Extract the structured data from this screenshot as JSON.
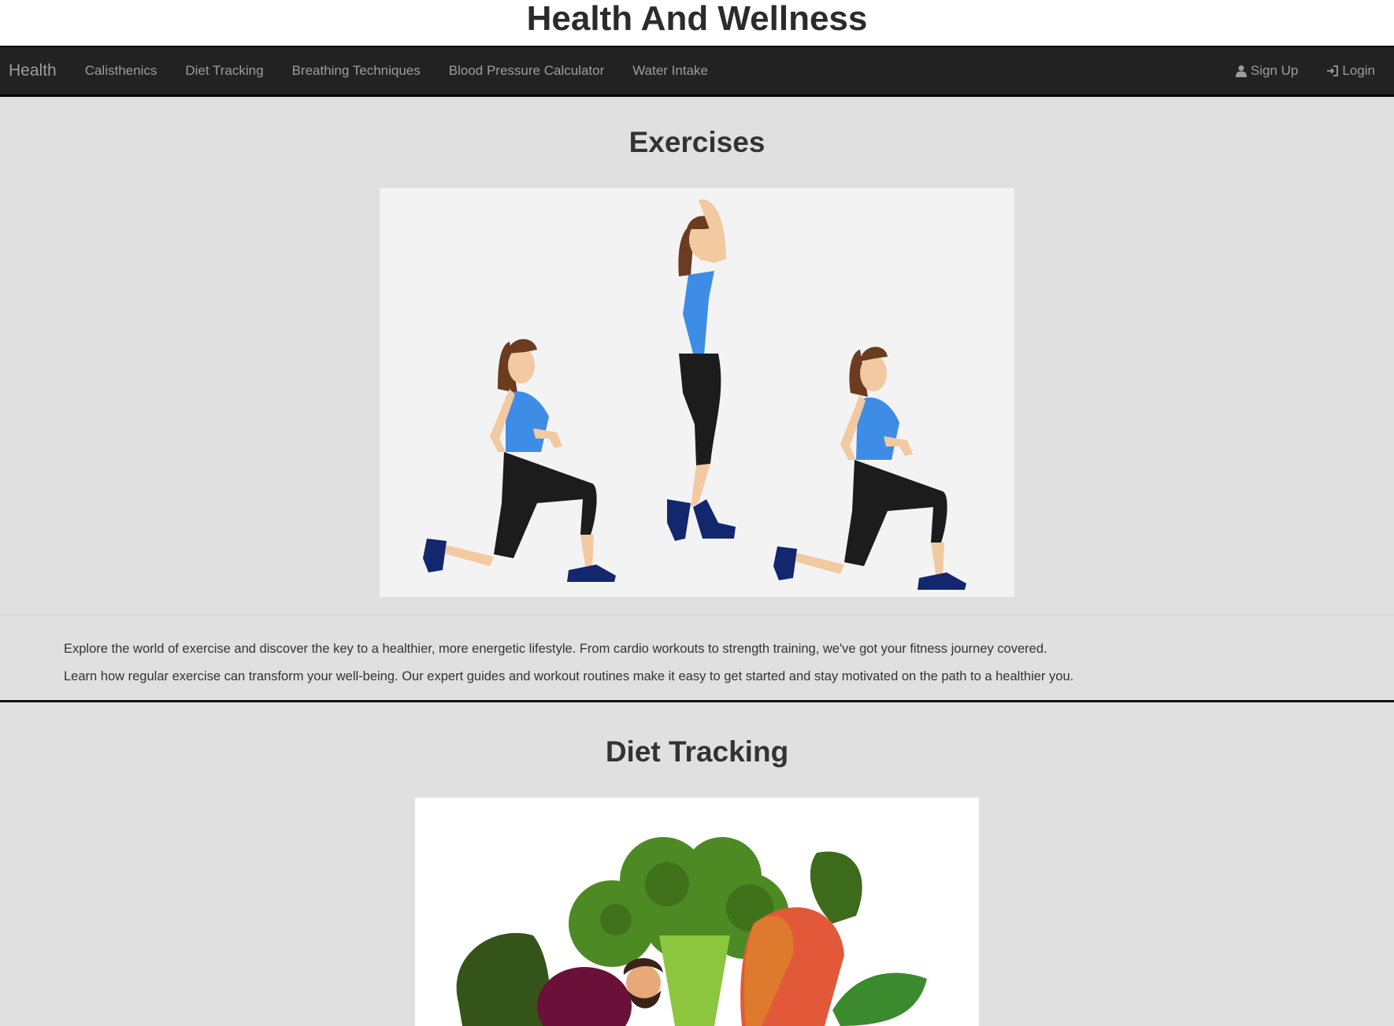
{
  "site": {
    "title": "Health And Wellness"
  },
  "navbar": {
    "brand": "Health",
    "links": [
      "Calisthenics",
      "Diet Tracking",
      "Breathing Techniques",
      "Blood Pressure Calculator",
      "Water Intake"
    ],
    "signup": "Sign Up",
    "login": "Login"
  },
  "sections": {
    "exercises": {
      "title": "Exercises",
      "paragraphs": [
        "Explore the world of exercise and discover the key to a healthier, more energetic lifestyle. From cardio workouts to strength training, we've got your fitness journey covered.",
        "Learn how regular exercise can transform your well-being. Our expert guides and workout routines make it easy to get started and stay motivated on the path to a healthier you."
      ]
    },
    "diet": {
      "title": "Diet Tracking"
    }
  },
  "colors": {
    "navbar_bg": "#222222",
    "nav_text": "#9d9d9d",
    "page_bg": "#e0e0e0",
    "shirt": "#3d8de6",
    "pants": "#1c1c1c",
    "shoes": "#13276e",
    "skin": "#f2c9a0",
    "hair": "#6b3c20"
  },
  "icons": {
    "signup": "user-icon",
    "login": "login-icon"
  }
}
